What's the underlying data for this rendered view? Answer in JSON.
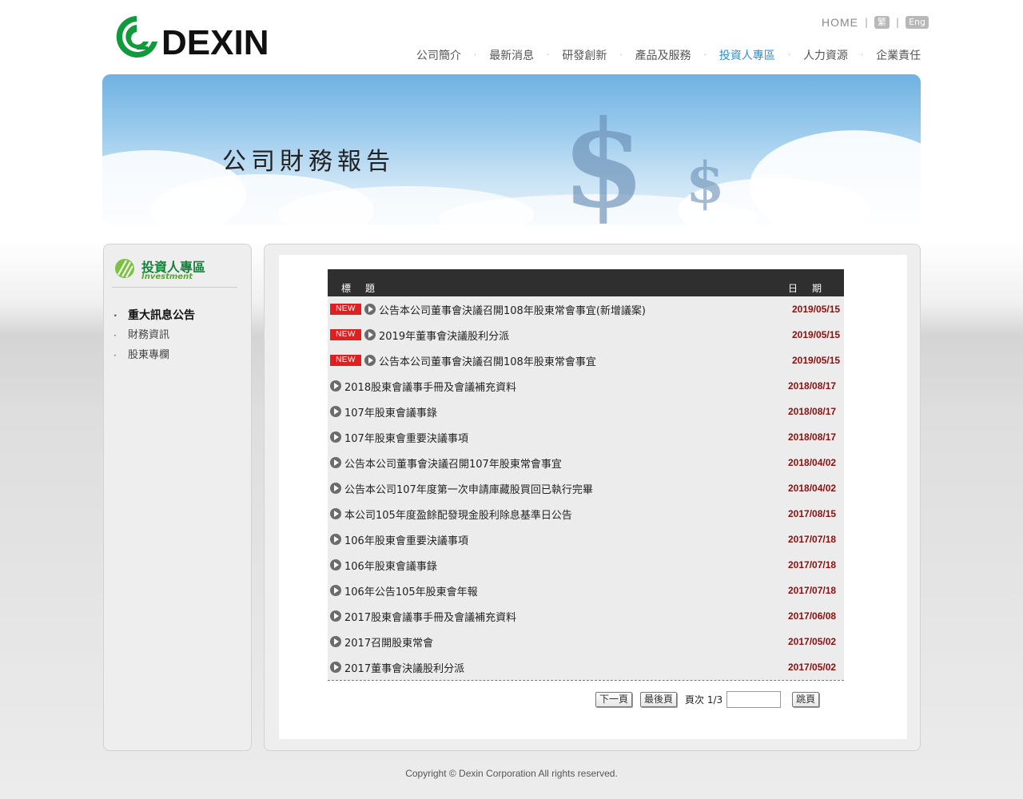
{
  "header": {
    "brand": "DEXIN",
    "home_label": "HOME",
    "lang_trad": "繁",
    "lang_eng": "Eng",
    "nav": [
      {
        "label": "公司簡介"
      },
      {
        "label": "最新消息"
      },
      {
        "label": "研發創新"
      },
      {
        "label": "產品及服務"
      },
      {
        "label": "投資人專區"
      },
      {
        "label": "人力資源"
      },
      {
        "label": "企業責任"
      }
    ],
    "active_nav": "投資人專區",
    "accent_color": "#2f8fd0",
    "brand_green": "#17803a"
  },
  "banner": {
    "title": "公司財務報告"
  },
  "sidebar": {
    "heading_cn": "投資人專區",
    "heading_en": "Investment",
    "items": [
      {
        "label": "重大訊息公告"
      },
      {
        "label": "財務資訊"
      },
      {
        "label": "股東專欄"
      }
    ]
  },
  "table": {
    "col_title": "標題",
    "col_date": "日期",
    "new_label": "NEW",
    "rows": [
      {
        "title": "公告本公司董事會決議召開108年股東常會事宜(新增議案)",
        "date": "2019/05/15",
        "new": true
      },
      {
        "title": "2019年董事會決議股利分派",
        "date": "2019/05/15",
        "new": true
      },
      {
        "title": "公告本公司董事會決議召開108年股東常會事宜",
        "date": "2019/05/15",
        "new": true
      },
      {
        "title": "2018股東會議事手冊及會議補充資料",
        "date": "2018/08/17",
        "new": false
      },
      {
        "title": "107年股東會議事錄",
        "date": "2018/08/17",
        "new": false
      },
      {
        "title": "107年股東會重要決議事項",
        "date": "2018/08/17",
        "new": false
      },
      {
        "title": "公告本公司董事會決議召開107年股東常會事宜",
        "date": "2018/04/02",
        "new": false
      },
      {
        "title": "公告本公司107年度第一次申請庫藏股買回已執行完畢",
        "date": "2018/04/02",
        "new": false
      },
      {
        "title": "本公司105年度盈餘配發現金股利除息基準日公告",
        "date": "2017/08/15",
        "new": false
      },
      {
        "title": "106年股東會重要決議事項",
        "date": "2017/07/18",
        "new": false
      },
      {
        "title": "106年股東會議事錄",
        "date": "2017/07/18",
        "new": false
      },
      {
        "title": "106年公告105年股東會年報",
        "date": "2017/07/18",
        "new": false
      },
      {
        "title": "2017股東會議事手冊及會議補充資料",
        "date": "2017/06/08",
        "new": false
      },
      {
        "title": "2017召開股東常會",
        "date": "2017/05/02",
        "new": false
      },
      {
        "title": "2017董事會決議股利分派",
        "date": "2017/05/02",
        "new": false
      }
    ]
  },
  "pager": {
    "next_label": "下一頁",
    "last_label": "最後頁",
    "page_info": "頁次 1/3",
    "jump_value": "",
    "jump_label": "跳頁"
  },
  "footer": {
    "copyright": "Copyright © Dexin Corporation All rights reserved."
  }
}
